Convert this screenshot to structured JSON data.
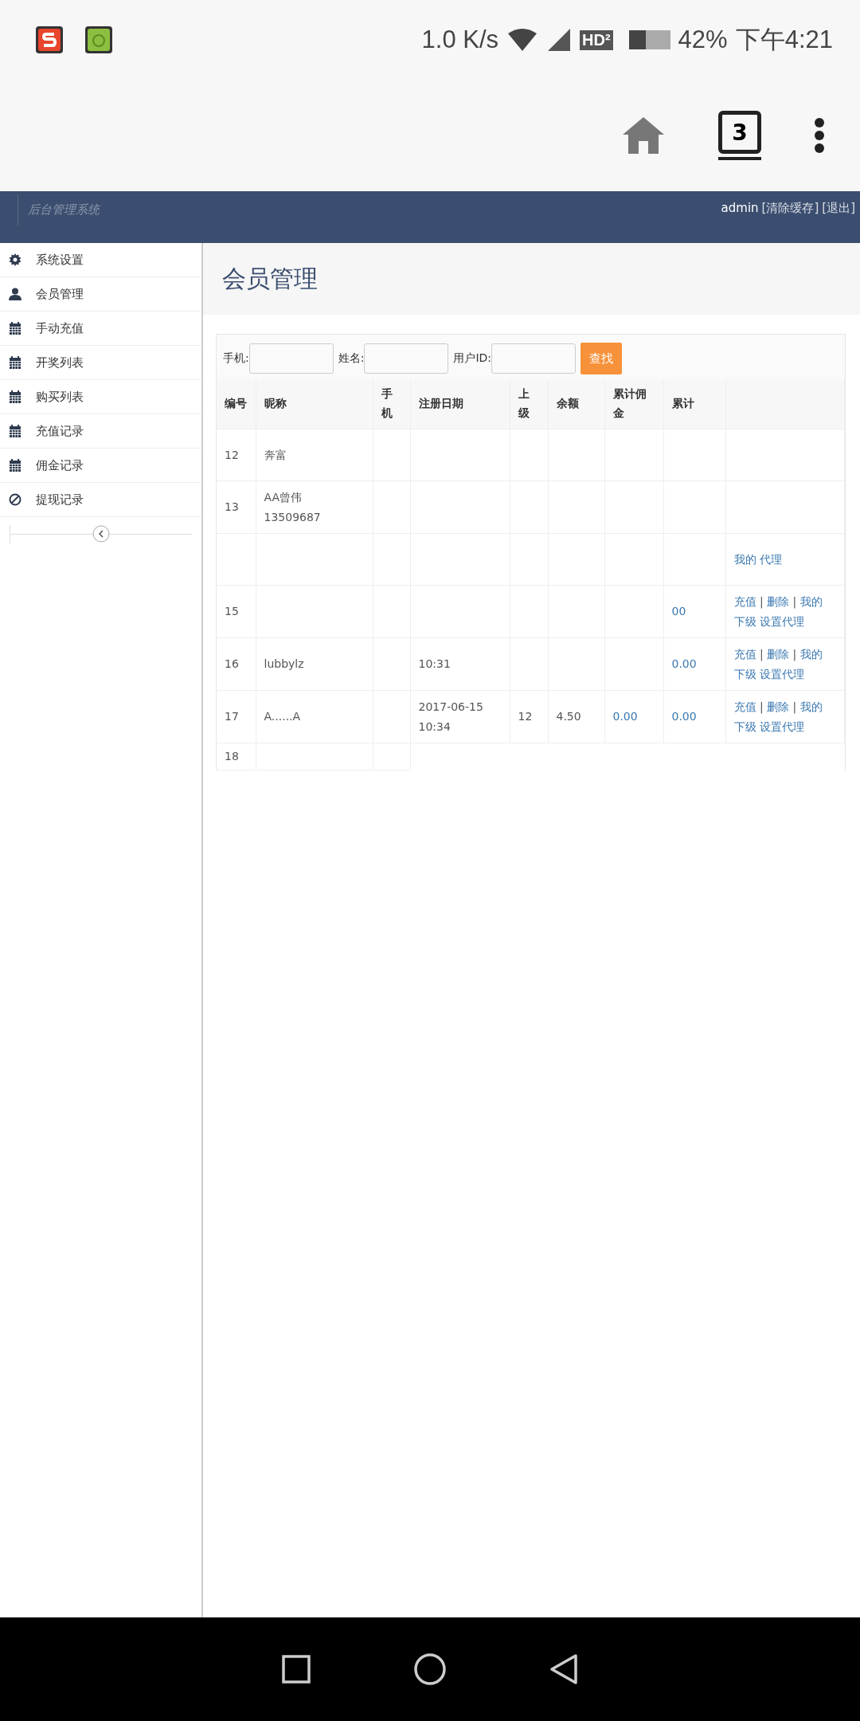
{
  "status_bar": {
    "speed": "1.0 K/s",
    "network_badge": "HD²",
    "battery": "42%",
    "time": "下午4:21"
  },
  "browser": {
    "tab_count": "3"
  },
  "header": {
    "title": "后台管理系统",
    "user": "admin",
    "links": [
      "[清除缓存]",
      "[退出]"
    ]
  },
  "sidebar": {
    "items": [
      {
        "label": "系统设置",
        "kind": "gear"
      },
      {
        "label": "会员管理",
        "kind": "user"
      },
      {
        "label": "手动充值",
        "kind": "calendar"
      },
      {
        "label": "开奖列表",
        "kind": "calendar"
      },
      {
        "label": "购买列表",
        "kind": "calendar"
      },
      {
        "label": "充值记录",
        "kind": "calendar"
      },
      {
        "label": "佣金记录",
        "kind": "calendar"
      },
      {
        "label": "提现记录",
        "kind": "ban"
      }
    ]
  },
  "page_title": "会员管理",
  "search": {
    "fields": [
      {
        "label": "手机:"
      },
      {
        "label": "姓名:"
      },
      {
        "label": "用户ID:"
      }
    ],
    "button": "查找"
  },
  "table": {
    "columns": [
      "编号",
      "昵称",
      "手机",
      "注册日期",
      "上级",
      "余额",
      "累计佣金",
      "累计",
      ""
    ],
    "rows": [
      {
        "id": "12",
        "nickname": [
          "奔富"
        ],
        "date": [],
        "parent": "",
        "balance": "",
        "commission": "",
        "col_8": "",
        "actions": []
      },
      {
        "id": "13",
        "nickname": [
          "AA曾伟",
          "13509687"
        ],
        "date": [],
        "parent": "",
        "balance": "",
        "commission": "",
        "col_8": "",
        "actions": []
      },
      {
        "id": "",
        "nickname": [],
        "date": [],
        "parent": "",
        "balance": "",
        "commission": "",
        "col_8": "",
        "actions": [
          {
            "label": "我的",
            "kind": "link"
          },
          {
            "label": "代理",
            "kind": "link"
          }
        ]
      },
      {
        "id": "15",
        "nickname": [],
        "date": [],
        "parent": "",
        "balance": "",
        "commission": "",
        "col_8": "00",
        "actions": [
          {
            "label": "充值",
            "kind": "link"
          },
          {
            "label": "|",
            "kind": "sep"
          },
          {
            "label": "删除",
            "kind": "link"
          },
          {
            "label": "|",
            "kind": "sep"
          },
          {
            "label": "我的",
            "kind": "link_break"
          },
          {
            "label": "下级",
            "kind": "link"
          },
          {
            "label": "设置代理",
            "kind": "link"
          }
        ]
      },
      {
        "id": "16",
        "nickname": [
          "lubbylz"
        ],
        "date": [
          "10:31"
        ],
        "parent": "",
        "balance": "",
        "commission": "",
        "col_8": "0.00",
        "actions": [
          {
            "label": "充值",
            "kind": "link"
          },
          {
            "label": "|",
            "kind": "sep"
          },
          {
            "label": "删除",
            "kind": "link"
          },
          {
            "label": "|",
            "kind": "sep"
          },
          {
            "label": "我的",
            "kind": "link_break"
          },
          {
            "label": "下级",
            "kind": "link"
          },
          {
            "label": "设置代理",
            "kind": "link"
          }
        ]
      },
      {
        "id": "17",
        "nickname": [
          "A......A"
        ],
        "date": [
          "2017-06-15",
          "10:34"
        ],
        "parent": "12",
        "balance": "4.50",
        "commission": "0.00",
        "col_8": "0.00",
        "actions": [
          {
            "label": "充值",
            "kind": "link"
          },
          {
            "label": "|",
            "kind": "sep"
          },
          {
            "label": "删除",
            "kind": "link"
          },
          {
            "label": "|",
            "kind": "sep"
          },
          {
            "label": "我的",
            "kind": "link_break"
          },
          {
            "label": "下级",
            "kind": "link"
          },
          {
            "label": "设置代理",
            "kind": "link"
          }
        ]
      }
    ],
    "partial_row": {
      "id": "18"
    }
  }
}
